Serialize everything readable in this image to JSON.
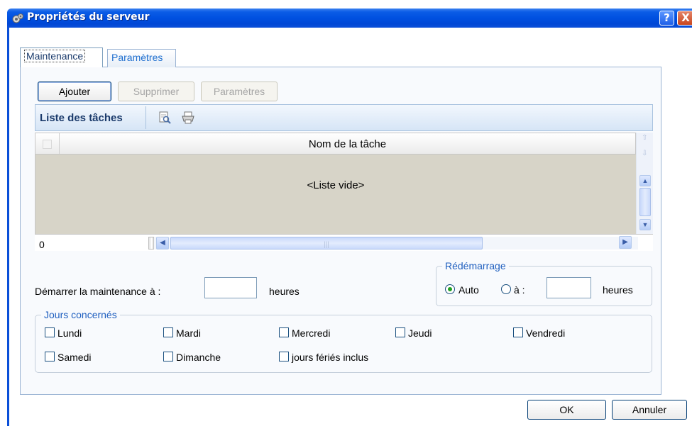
{
  "window": {
    "title": "Propriétés du serveur",
    "help_label": "?",
    "close_label": "X"
  },
  "tabs": [
    {
      "label": "Maintenance",
      "active": true
    },
    {
      "label": "Paramètres",
      "active": false
    }
  ],
  "toolbar": {
    "add_label": "Ajouter",
    "delete_label": "Supprimer",
    "params_label": "Paramètres"
  },
  "task_list": {
    "title": "Liste des tâches",
    "icons": [
      "preview-icon",
      "print-icon"
    ],
    "column_header": "Nom de la tâche",
    "empty_text": "<Liste vide>",
    "count": "0"
  },
  "maintenance": {
    "start_label": "Démarrer la maintenance à :",
    "start_value": "",
    "unit_label": "heures"
  },
  "restart": {
    "legend": "Rédémarrage",
    "auto_label": "Auto",
    "at_label": "à :",
    "at_value": "",
    "unit_label": "heures",
    "selected": "Auto"
  },
  "days": {
    "legend": "Jours concernés",
    "items": [
      {
        "label": "Lundi",
        "checked": false
      },
      {
        "label": "Mardi",
        "checked": false
      },
      {
        "label": "Mercredi",
        "checked": false
      },
      {
        "label": "Jeudi",
        "checked": false
      },
      {
        "label": "Vendredi",
        "checked": false
      },
      {
        "label": "Samedi",
        "checked": false
      },
      {
        "label": "Dimanche",
        "checked": false
      },
      {
        "label": "jours fériés inclus",
        "checked": false
      }
    ]
  },
  "footer": {
    "ok_label": "OK",
    "cancel_label": "Annuler"
  },
  "colors": {
    "titlebar": "#0050e0",
    "accent": "#1f5fbf",
    "list_empty_bg": "#d7d4c8"
  }
}
